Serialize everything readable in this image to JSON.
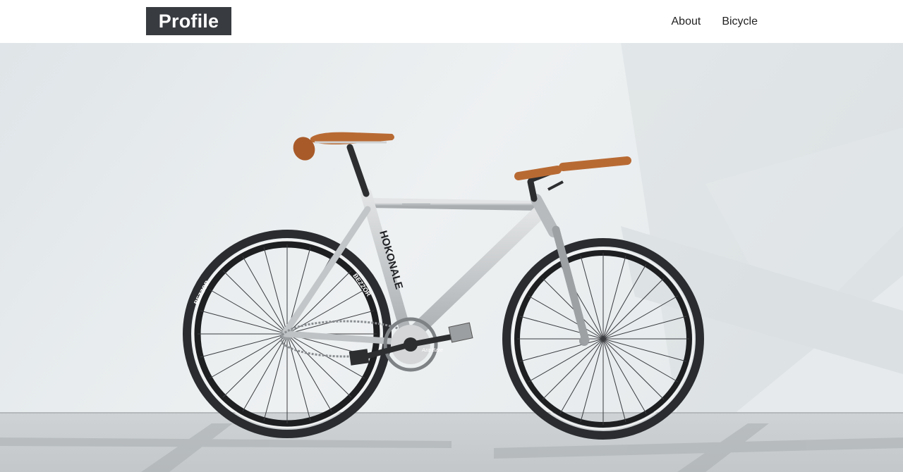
{
  "header": {
    "logo_text": "Profile",
    "nav": [
      {
        "label": "About"
      },
      {
        "label": "Bicycle"
      }
    ]
  },
  "hero": {
    "image": "bicycle-photo",
    "frame_text": "HOKONALE",
    "tire_text": "BEZZOR",
    "crank_text": "Aza-Bzze"
  },
  "colors": {
    "logo_bg": "#383b40",
    "wall": "#e7ecee",
    "floor": "#c9cdcf",
    "frame": "#c6c9cb",
    "leather": "#b86a33"
  }
}
